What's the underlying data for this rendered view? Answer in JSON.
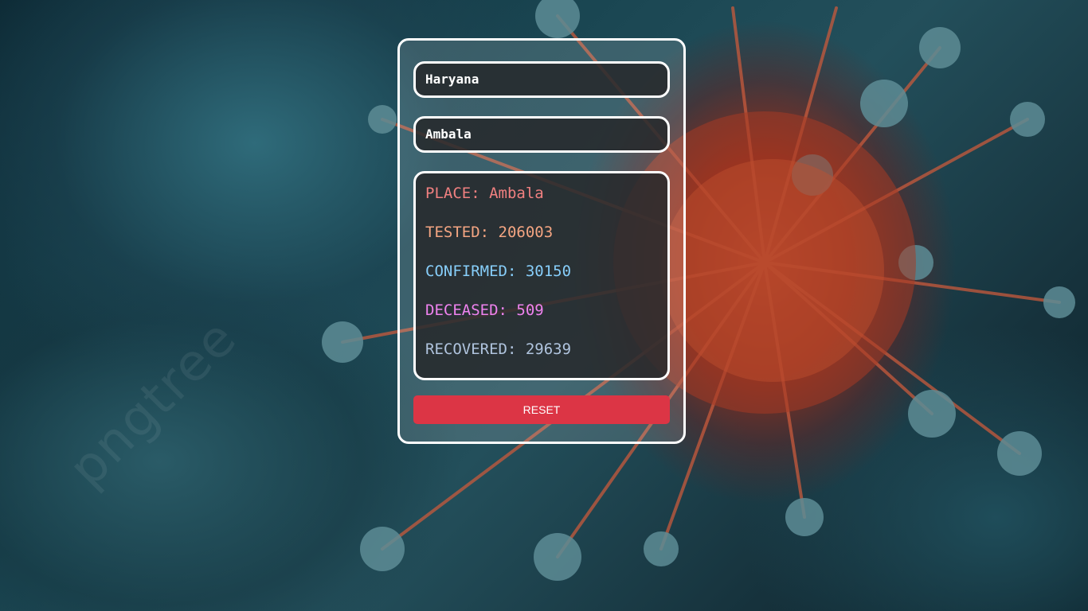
{
  "form": {
    "state_value": "Haryana",
    "district_value": "Ambala"
  },
  "stats": {
    "place": "PLACE: Ambala",
    "tested": "TESTED: 206003",
    "confirmed": "CONFIRMED: 30150",
    "deceased": "DECEASED: 509",
    "recovered": "RECOVERED: 29639"
  },
  "colors": {
    "place": "#f08080",
    "tested": "#f4a582",
    "confirmed": "#87cefa",
    "deceased": "#ee82ee",
    "recovered": "#b0c4de",
    "reset_button": "#dc3545"
  },
  "actions": {
    "reset_label": "RESET"
  },
  "background": {
    "watermark_text": "pngtree"
  }
}
